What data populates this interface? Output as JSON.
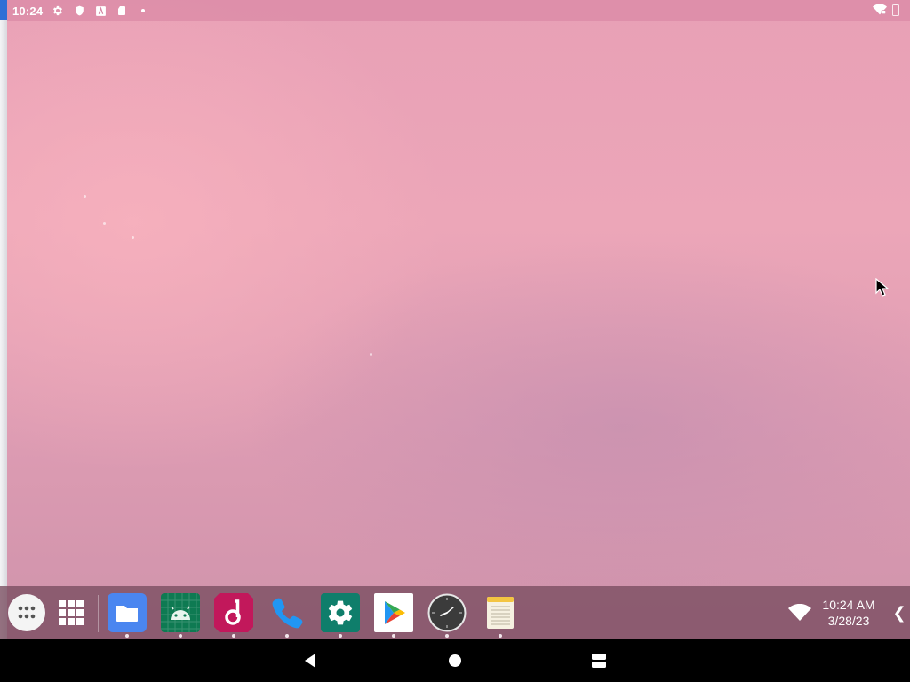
{
  "status_bar": {
    "time": "10:24",
    "left_icons": [
      "gear-icon",
      "shield-icon",
      "text-a-icon",
      "sd-card-icon",
      "dot-icon"
    ],
    "right_icons": [
      "wifi-vpn-icon",
      "battery-icon"
    ]
  },
  "taskbar": {
    "launcher_icons": [
      "app-drawer-icon",
      "recent-apps-grid-icon"
    ],
    "pinned_apps": [
      {
        "name": "Files",
        "icon": "folder-icon",
        "color": "#4a86f0",
        "running": true
      },
      {
        "name": "Android",
        "icon": "android-icon",
        "color": "#0e7a52",
        "running": true
      },
      {
        "name": "Music",
        "icon": "music-note-icon",
        "color": "#c2185b",
        "running": true
      },
      {
        "name": "Phone",
        "icon": "phone-icon",
        "color": "#2196f3",
        "running": true
      },
      {
        "name": "Settings",
        "icon": "gear-icon",
        "color": "#0f7e6b",
        "running": true
      },
      {
        "name": "Play Store",
        "icon": "play-store-icon",
        "color": "#ffffff",
        "running": true
      },
      {
        "name": "Clock",
        "icon": "clock-icon",
        "color": "#3b3b3b",
        "running": true
      },
      {
        "name": "Notes",
        "icon": "notepad-icon",
        "color": "#f4c542",
        "running": true
      }
    ],
    "tray": {
      "time": "10:24 AM",
      "date": "3/28/23",
      "wifi_icon": "wifi-icon",
      "expand_glyph": "❮"
    }
  },
  "nav_bar": {
    "buttons": [
      "back-icon",
      "home-icon",
      "recents-icon"
    ]
  },
  "colors": {
    "wallpaper_top": "#e8a0b6",
    "wallpaper_bottom": "#cf93ab",
    "taskbar": "#784b5f",
    "nav_bar": "#000000"
  }
}
